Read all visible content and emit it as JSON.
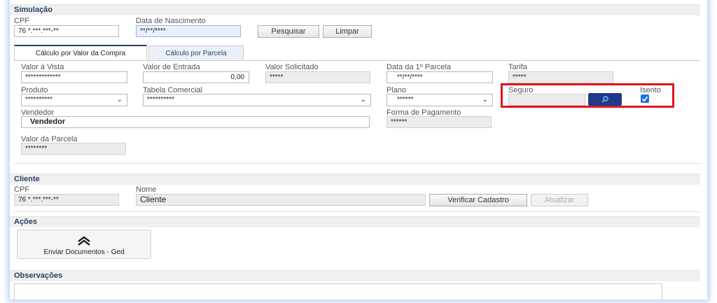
{
  "simulacao": {
    "section_title": "Simulação",
    "cpf_label": "CPF",
    "cpf_value": "76 *.***.***-**",
    "nascimento_label": "Data de Nascimento",
    "nascimento_value": "**/**/****",
    "pesquisar_label": "Pesquisar",
    "limpar_label": "Limpar"
  },
  "tabs": [
    {
      "label": "Cálculo por Valor da Compra"
    },
    {
      "label": "Cálculo por Parcela"
    }
  ],
  "form": {
    "valor_vista_label": "Valor à Vista",
    "valor_vista_value": "*************",
    "valor_entrada_label": "Valor de Entrada",
    "valor_entrada_value": "0,00",
    "valor_solicitado_label": "Valor Solicitado",
    "valor_solicitado_value": "*****",
    "data_parcela_label": "Data da 1º Parcela",
    "data_parcela_value": "**/**/****",
    "tarifa_label": "Tarifa",
    "tarifa_value": "*****",
    "produto_label": "Produto",
    "produto_value": "**********",
    "tabela_label": "Tabela Comercial",
    "tabela_value": "**********",
    "plano_label": "Plano",
    "plano_value": "******",
    "seguro_label": "Seguro",
    "seguro_value": "",
    "isento_label": "Isento",
    "isento_checked": true,
    "vendedor_label": "Vendedor",
    "vendedor_value": "Vendedor",
    "forma_pagamento_label": "Forma de Pagamento",
    "forma_pagamento_value": "******",
    "valor_parcela_label": "Valor da Parcela",
    "valor_parcela_value": "********"
  },
  "cliente": {
    "section_title": "Cliente",
    "cpf_label": "CPF",
    "cpf_value": "76 *.***.***-**",
    "nome_label": "Nome",
    "nome_value": "Cliente",
    "verificar_label": "Verificar Cadastro",
    "atualizar_label": "Atualizar"
  },
  "acoes": {
    "section_title": "Ações",
    "enviar_label": "Enviar Documentos - Ged"
  },
  "observacoes": {
    "section_title": "Observações"
  },
  "colors": {
    "highlight_box": "#e0141e",
    "primary_button": "#1f3a8a",
    "section_title": "#2b3f66"
  }
}
